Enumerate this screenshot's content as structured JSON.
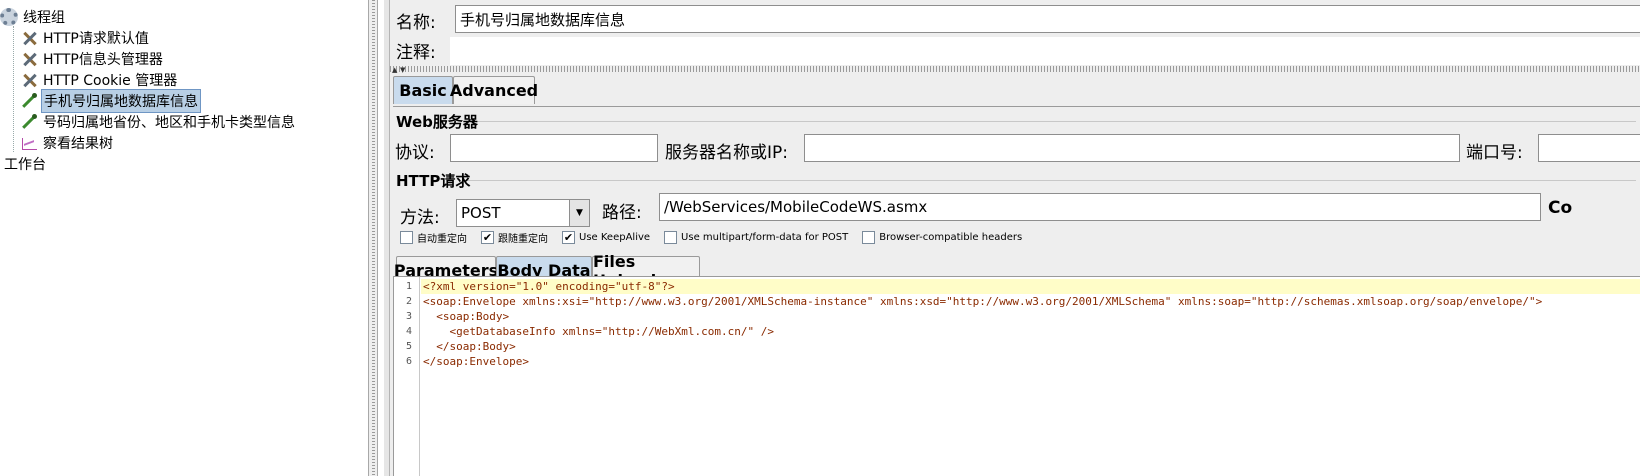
{
  "tree": {
    "items": [
      {
        "label": "线程组",
        "icon": "gear-icon"
      },
      {
        "label": "HTTP请求默认值",
        "icon": "tools-icon"
      },
      {
        "label": "HTTP信息头管理器",
        "icon": "tools-icon"
      },
      {
        "label": "HTTP Cookie 管理器",
        "icon": "tools-icon"
      },
      {
        "label": "手机号归属地数据库信息",
        "icon": "sampler-icon",
        "selected": true
      },
      {
        "label": "号码归属地省份、地区和手机卡类型信息",
        "icon": "sampler-icon"
      },
      {
        "label": "察看结果树",
        "icon": "results-tree-icon"
      },
      {
        "label": "工作台",
        "icon": ""
      }
    ]
  },
  "form": {
    "name_label": "名称:",
    "name_value": "手机号归属地数据库信息",
    "comment_label": "注释:",
    "comment_value": ""
  },
  "tabs": {
    "basic": "Basic",
    "advanced": "Advanced"
  },
  "web_server": {
    "title": "Web服务器",
    "protocol_label": "协议:",
    "protocol_value": "",
    "server_label": "服务器名称或IP:",
    "server_value": "",
    "port_label": "端口号:",
    "port_value": ""
  },
  "http_request": {
    "title": "HTTP请求",
    "method_label": "方法:",
    "method_value": "POST",
    "path_label": "路径:",
    "path_value": "/WebServices/MobileCodeWS.asmx",
    "content_label": "Co"
  },
  "options": [
    {
      "label": "自动重定向",
      "checked": false
    },
    {
      "label": "跟随重定向",
      "checked": true
    },
    {
      "label": "Use KeepAlive",
      "checked": true
    },
    {
      "label": "Use multipart/form-data for POST",
      "checked": false
    },
    {
      "label": "Browser-compatible headers",
      "checked": false
    }
  ],
  "subtabs": {
    "parameters": "Parameters",
    "body_data": "Body Data",
    "files_upload": "Files Upload"
  },
  "editor": {
    "lines": [
      {
        "n": "1",
        "text": "<?xml version=\"1.0\" encoding=\"utf-8\"?>"
      },
      {
        "n": "2",
        "text": "<soap:Envelope xmlns:xsi=\"http://www.w3.org/2001/XMLSchema-instance\" xmlns:xsd=\"http://www.w3.org/2001/XMLSchema\" xmlns:soap=\"http://schemas.xmlsoap.org/soap/envelope/\">"
      },
      {
        "n": "3",
        "text": "  <soap:Body>"
      },
      {
        "n": "4",
        "text": "    <getDatabaseInfo xmlns=\"http://WebXml.com.cn/\" />"
      },
      {
        "n": "5",
        "text": "  </soap:Body>"
      },
      {
        "n": "6",
        "text": "</soap:Envelope>"
      }
    ]
  }
}
